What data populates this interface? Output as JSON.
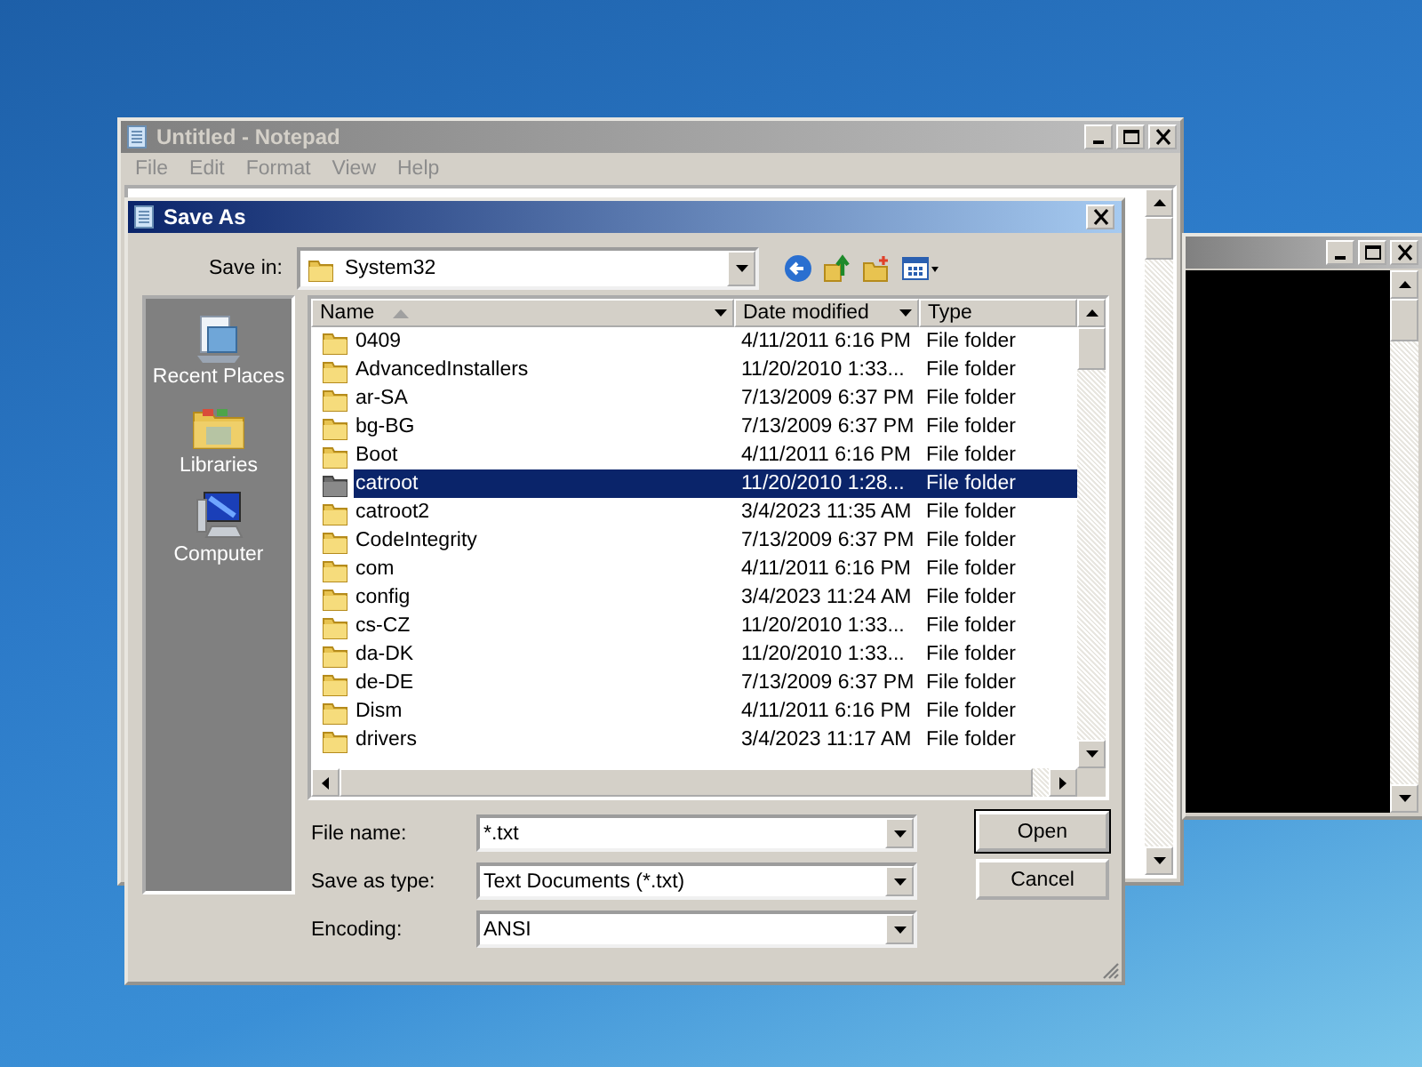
{
  "notepad": {
    "title": "Untitled - Notepad",
    "menu": [
      "File",
      "Edit",
      "Format",
      "View",
      "Help"
    ]
  },
  "dialog": {
    "title": "Save As",
    "save_in": {
      "label": "Save in:",
      "value": "System32"
    },
    "places": [
      {
        "kind": "recent",
        "label": "Recent Places"
      },
      {
        "kind": "libraries",
        "label": "Libraries"
      },
      {
        "kind": "computer",
        "label": "Computer"
      }
    ],
    "columns": [
      {
        "label": "Name",
        "sorted": true
      },
      {
        "label": "Date modified",
        "sorted": false
      },
      {
        "label": "Type",
        "sorted": false
      }
    ],
    "rows": [
      {
        "name": "0409",
        "date": "4/11/2011 6:16 PM",
        "type": "File folder",
        "selected": false
      },
      {
        "name": "AdvancedInstallers",
        "date": "11/20/2010 1:33...",
        "type": "File folder",
        "selected": false
      },
      {
        "name": "ar-SA",
        "date": "7/13/2009 6:37 PM",
        "type": "File folder",
        "selected": false
      },
      {
        "name": "bg-BG",
        "date": "7/13/2009 6:37 PM",
        "type": "File folder",
        "selected": false
      },
      {
        "name": "Boot",
        "date": "4/11/2011 6:16 PM",
        "type": "File folder",
        "selected": false
      },
      {
        "name": "catroot",
        "date": "11/20/2010 1:28...",
        "type": "File folder",
        "selected": true
      },
      {
        "name": "catroot2",
        "date": "3/4/2023 11:35 AM",
        "type": "File folder",
        "selected": false
      },
      {
        "name": "CodeIntegrity",
        "date": "7/13/2009 6:37 PM",
        "type": "File folder",
        "selected": false
      },
      {
        "name": "com",
        "date": "4/11/2011 6:16 PM",
        "type": "File folder",
        "selected": false
      },
      {
        "name": "config",
        "date": "3/4/2023 11:24 AM",
        "type": "File folder",
        "selected": false
      },
      {
        "name": "cs-CZ",
        "date": "11/20/2010 1:33...",
        "type": "File folder",
        "selected": false
      },
      {
        "name": "da-DK",
        "date": "11/20/2010 1:33...",
        "type": "File folder",
        "selected": false
      },
      {
        "name": "de-DE",
        "date": "7/13/2009 6:37 PM",
        "type": "File folder",
        "selected": false
      },
      {
        "name": "Dism",
        "date": "4/11/2011 6:16 PM",
        "type": "File folder",
        "selected": false
      },
      {
        "name": "drivers",
        "date": "3/4/2023 11:17 AM",
        "type": "File folder",
        "selected": false
      }
    ],
    "fields": [
      {
        "label": "File name:",
        "value": "*.txt"
      },
      {
        "label": "Save as type:",
        "value": "Text Documents (*.txt)"
      },
      {
        "label": "Encoding:",
        "value": "ANSI"
      }
    ],
    "buttons": [
      "Open",
      "Cancel"
    ]
  }
}
